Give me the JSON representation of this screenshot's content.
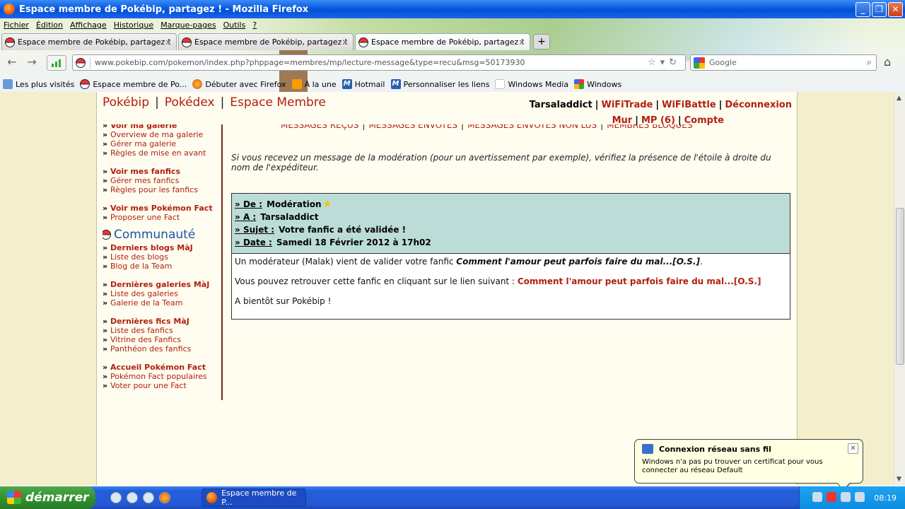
{
  "window": {
    "title": "Espace membre de Pokébip, partagez ! - Mozilla Firefox"
  },
  "menu": [
    "Fichier",
    "Édition",
    "Affichage",
    "Historique",
    "Marque-pages",
    "Outils",
    "?"
  ],
  "tabs": [
    {
      "label": "Espace membre de Pokébip, partagez !"
    },
    {
      "label": "Espace membre de Pokébip, partagez !"
    },
    {
      "label": "Espace membre de Pokébip, partagez !"
    }
  ],
  "nav": {
    "url": "www.pokebip.com/pokemon/index.php?phppage=membres/mp/lecture-message&type=recu&msg=50173930",
    "search_placeholder": "Google"
  },
  "bookmarks": [
    "Les plus visités",
    "Espace membre de Po...",
    "Débuter avec Firefox",
    "À la une",
    "Hotmail",
    "Personnaliser les liens",
    "Windows Media",
    "Windows"
  ],
  "site": {
    "nav": [
      "Pokébip",
      "Pokédex",
      "Espace Membre"
    ],
    "username": "Tarsaladdict",
    "user_links": [
      "WiFiTrade",
      "WiFiBattle",
      "Déconnexion"
    ],
    "user_links2": [
      "Mur",
      "MP (6)",
      "Compte"
    ]
  },
  "msg_tabs": [
    "MESSAGES REÇUS",
    "MESSAGES ENVOYÉS",
    "MESSAGES ENVOYÉS NON LUS",
    "MEMBRES BLOQUÉS"
  ],
  "sidebar": {
    "group1": [
      "Voir ma galerie",
      "Overview de ma galerie",
      "Gérer ma galerie",
      "Règles de mise en avant"
    ],
    "group2": [
      "Voir mes fanfics",
      "Gérer mes fanfics",
      "Règles pour les fanfics"
    ],
    "group3": [
      "Voir mes Pokémon Fact",
      "Proposer une Fact"
    ],
    "section_title": "Communauté",
    "group4": [
      "Derniers blogs MàJ",
      "Liste des blogs",
      "Blog de la Team"
    ],
    "group5": [
      "Dernières galeries MàJ",
      "Liste des galeries",
      "Galerie de la Team"
    ],
    "group6": [
      "Dernières fics MàJ",
      "Liste des fanfics",
      "Vitrine des Fanfics",
      "Panthéon des fanfics"
    ],
    "group7": [
      "Accueil Pokémon Fact",
      "Pokémon Fact populaires",
      "Voter pour une Fact"
    ]
  },
  "content": {
    "note": "Si vous recevez un message de la modération (pour un avertissement par exemple), vérifiez la présence de l'étoile à droite du nom de l'expéditeur.",
    "header": {
      "from_label": "De :",
      "from": "Modération",
      "to_label": "A :",
      "to": "Tarsaladdict",
      "subject_label": "Sujet :",
      "subject": "Votre fanfic a été validée !",
      "date_label": "Date :",
      "date": "Samedi 18 Février 2012 à 17h02"
    },
    "body_line1_pre": "Un modérateur (Malak) vient de valider votre fanfic ",
    "fic_title": "Comment l'amour peut parfois faire du mal...[O.S.]",
    "body_line1_post": ".",
    "body_line2_pre": "Vous pouvez retrouver cette fanfic en cliquant sur le lien suivant : ",
    "link_text": "Comment l'amour peut parfois faire du mal...[O.S.]",
    "body_line3": "A bientôt sur Pokébip !"
  },
  "taskbar": {
    "start_label": "démarrer",
    "task_label": "Espace membre de P...",
    "clock": "08:19"
  },
  "balloon": {
    "title": "Connexion réseau sans fil",
    "text": "Windows n'a pas pu trouver un certificat pour vous connecter au réseau Default"
  }
}
